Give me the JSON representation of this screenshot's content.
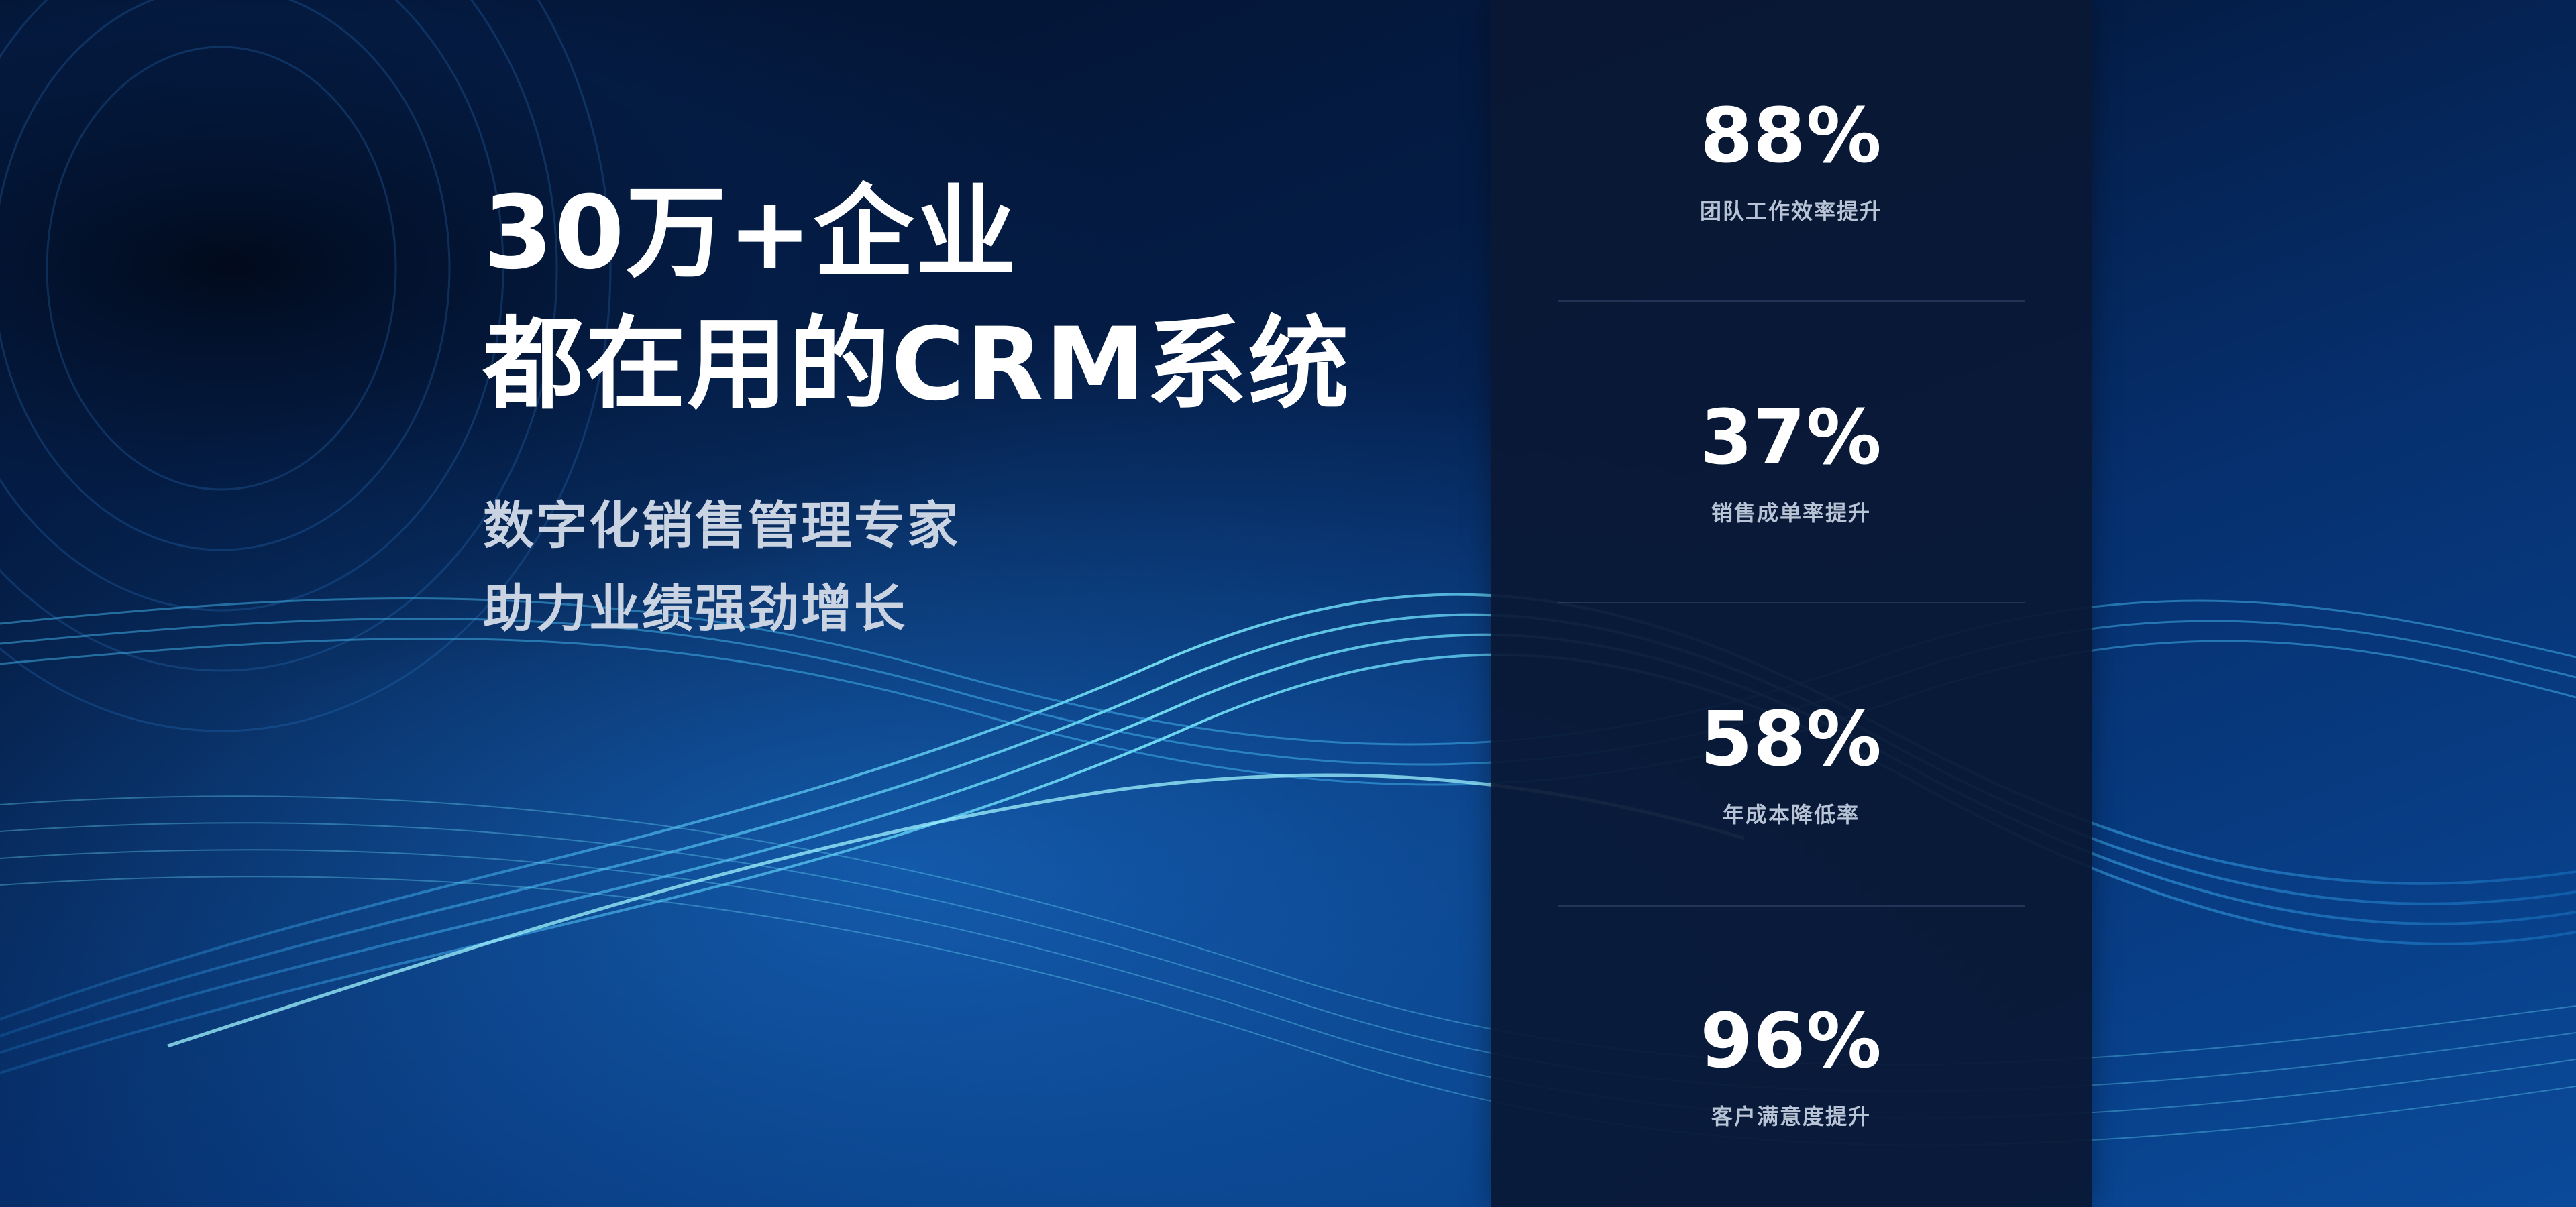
{
  "hero": {
    "headline_line1": "30万+企业",
    "headline_line2": "都在用的CRM系统",
    "subline1": "数字化销售管理专家",
    "subline2": "助力业绩强劲增长"
  },
  "stats": [
    {
      "value": "88%",
      "label": "团队工作效率提升"
    },
    {
      "value": "37%",
      "label": "销售成单率提升"
    },
    {
      "value": "58%",
      "label": "年成本降低率"
    },
    {
      "value": "96%",
      "label": "客户满意度提升"
    }
  ],
  "colors": {
    "background_dark": "#03102a",
    "background_blue": "#0a4a9a",
    "wave_cyan": "#3ad0ff",
    "panel": "#0a1834",
    "text_primary": "#ffffff",
    "text_secondary": "#c9d3e2"
  }
}
